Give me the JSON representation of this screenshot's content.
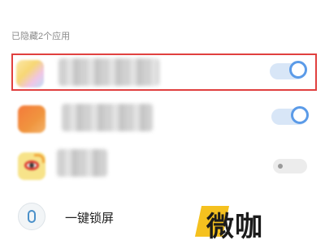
{
  "section": {
    "title": "已隐藏2个应用"
  },
  "apps": [
    {
      "icon": "blurred-app-icon",
      "toggle_on": true
    },
    {
      "icon": "blurred-orange-app-icon",
      "toggle_on": true
    },
    {
      "icon": "weibo-icon",
      "toggle_on": false
    }
  ],
  "lock_row": {
    "icon": "lock-icon",
    "label": "一键锁屏"
  },
  "watermark": {
    "text": "微咖"
  },
  "colors": {
    "accent": "#5b9be8",
    "highlight_border": "#e0403f",
    "watermark_bg": "#f5c11f"
  }
}
